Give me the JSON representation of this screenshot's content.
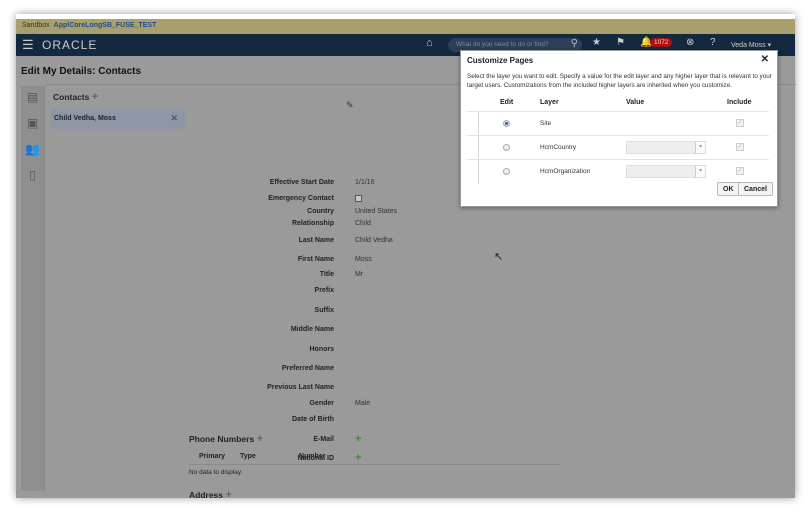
{
  "sandbox": {
    "label": "Sandbox",
    "name": "ApplCoreLongSB_FUSE_TEST"
  },
  "nav": {
    "logo": "ORACLE",
    "search_placeholder": "What do you need to do or find?",
    "notifications": "1072",
    "user": "Veda Moss"
  },
  "page": {
    "title": "Edit My Details: Contacts"
  },
  "contacts": {
    "heading": "Contacts",
    "selected": "Child Vedha, Moss"
  },
  "form": [
    {
      "label": "Effective Start Date",
      "value": "1/1/16"
    },
    {
      "label": "Emergency Contact",
      "value": ""
    },
    {
      "label": "Country",
      "value": "United States"
    },
    {
      "label": "Relationship",
      "value": "Child"
    },
    {
      "label": "Last Name",
      "value": "Child Vedha"
    },
    {
      "label": "First Name",
      "value": "Moss"
    },
    {
      "label": "Title",
      "value": "Mr"
    },
    {
      "label": "Prefix",
      "value": ""
    },
    {
      "label": "Suffix",
      "value": ""
    },
    {
      "label": "Middle Name",
      "value": ""
    },
    {
      "label": "Honors",
      "value": ""
    },
    {
      "label": "Preferred Name",
      "value": ""
    },
    {
      "label": "Previous Last Name",
      "value": ""
    },
    {
      "label": "Gender",
      "value": "Male"
    },
    {
      "label": "Date of Birth",
      "value": ""
    },
    {
      "label": "E-Mail",
      "value": ""
    },
    {
      "label": "National ID",
      "value": ""
    }
  ],
  "phone": {
    "heading": "Phone Numbers",
    "columns": [
      "Primary",
      "Type",
      "Number"
    ],
    "empty": "No data to display."
  },
  "address": {
    "heading": "Address"
  },
  "modal": {
    "title": "Customize Pages",
    "description": "Select the layer you want to edit. Specify a value for the edit layer and any higher layer that is relevant to your target users. Customizations from the included higher layers are inherited when you customize.",
    "columns": [
      "Edit",
      "Layer",
      "Value",
      "Include"
    ],
    "rows": [
      {
        "layer": "Site",
        "selected": true,
        "include": true
      },
      {
        "layer": "HcmCountry",
        "selected": false,
        "include": true
      },
      {
        "layer": "HcmOrganization",
        "selected": false,
        "include": true
      }
    ],
    "ok": "OK",
    "cancel": "Cancel"
  }
}
